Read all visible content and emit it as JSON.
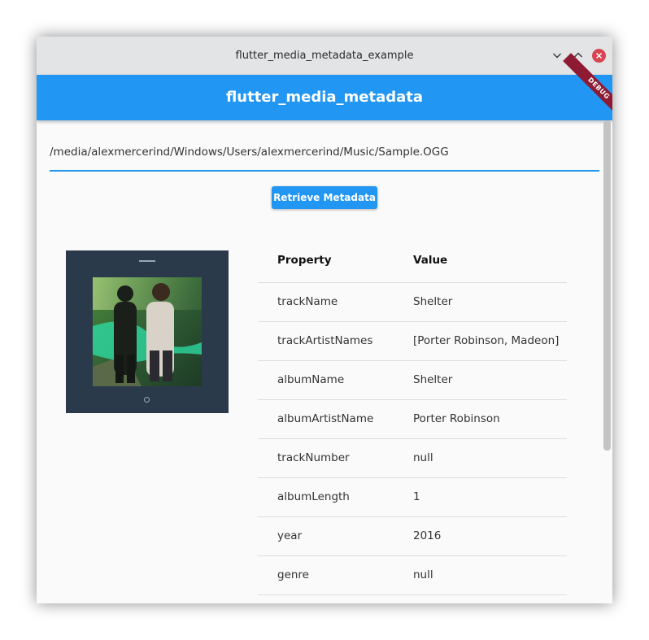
{
  "window": {
    "title": "flutter_media_metadata_example",
    "controls": {
      "minimize_icon": "chevron-down-icon",
      "maximize_icon": "chevron-up-icon",
      "close_icon": "close-icon"
    }
  },
  "appbar": {
    "title": "flutter_media_metadata",
    "debug_banner": "DEBUG",
    "color": "#2196f3"
  },
  "path_input": {
    "value": "/media/alexmercerind/Windows/Users/alexmercerind/Music/Sample.OGG"
  },
  "retrieve_button": {
    "label": "Retrieve Metadata"
  },
  "album_art": {
    "description": "album-art-image"
  },
  "table": {
    "headers": {
      "property": "Property",
      "value": "Value"
    },
    "rows": [
      {
        "property": "trackName",
        "value": "Shelter"
      },
      {
        "property": "trackArtistNames",
        "value": "[Porter Robinson, Madeon]"
      },
      {
        "property": "albumName",
        "value": "Shelter"
      },
      {
        "property": "albumArtistName",
        "value": "Porter Robinson"
      },
      {
        "property": "trackNumber",
        "value": "null"
      },
      {
        "property": "albumLength",
        "value": "1"
      },
      {
        "property": "year",
        "value": "2016"
      },
      {
        "property": "genre",
        "value": "null"
      }
    ]
  }
}
